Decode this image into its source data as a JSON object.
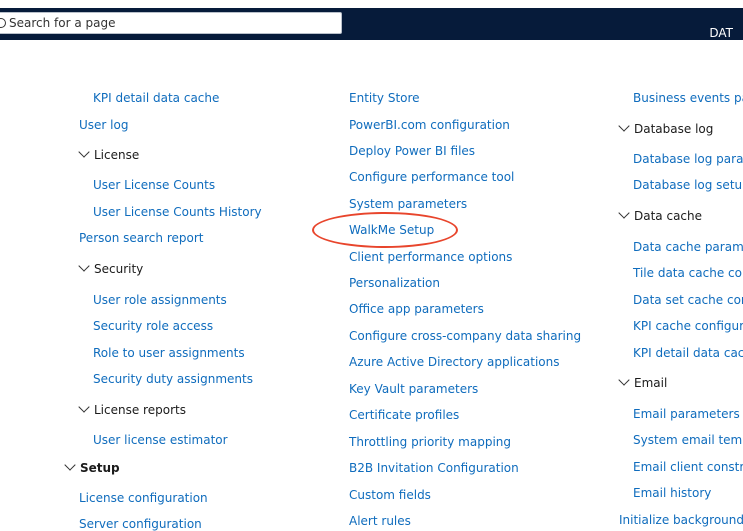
{
  "header": {
    "search_placeholder": "Search for a page",
    "company": "DAT"
  },
  "columns": [
    [
      {
        "label": "KPI detail data cache",
        "type": "link"
      },
      {
        "label": "User log",
        "type": "link"
      },
      {
        "label": "License",
        "type": "group"
      },
      {
        "label": "User License Counts",
        "type": "link"
      },
      {
        "label": "User License Counts History",
        "type": "link"
      },
      {
        "label": "Person search report",
        "type": "link"
      },
      {
        "label": "Security",
        "type": "group"
      },
      {
        "label": "User role assignments",
        "type": "link"
      },
      {
        "label": "Security role access",
        "type": "link"
      },
      {
        "label": "Role to user assignments",
        "type": "link"
      },
      {
        "label": "Security duty assignments",
        "type": "link"
      },
      {
        "label": "License reports",
        "type": "group"
      },
      {
        "label": "User license estimator",
        "type": "link"
      },
      {
        "label": "Setup",
        "type": "group"
      },
      {
        "label": "License configuration",
        "type": "link"
      },
      {
        "label": "Server configuration",
        "type": "link"
      }
    ],
    [
      {
        "label": "Entity Store",
        "type": "link"
      },
      {
        "label": "PowerBI.com configuration",
        "type": "link"
      },
      {
        "label": "Deploy Power BI files",
        "type": "link"
      },
      {
        "label": "Configure performance tool",
        "type": "link"
      },
      {
        "label": "System parameters",
        "type": "link"
      },
      {
        "label": "WalkMe Setup",
        "type": "link"
      },
      {
        "label": "Client performance options",
        "type": "link"
      },
      {
        "label": "Personalization",
        "type": "link"
      },
      {
        "label": "Office app parameters",
        "type": "link"
      },
      {
        "label": "Configure cross-company data sharing",
        "type": "link"
      },
      {
        "label": "Azure Active Directory applications",
        "type": "link"
      },
      {
        "label": "Key Vault parameters",
        "type": "link"
      },
      {
        "label": "Certificate profiles",
        "type": "link"
      },
      {
        "label": "Throttling priority mapping",
        "type": "link"
      },
      {
        "label": "B2B Invitation Configuration",
        "type": "link"
      },
      {
        "label": "Custom fields",
        "type": "link"
      },
      {
        "label": "Alert rules",
        "type": "link"
      }
    ],
    [
      {
        "label": "Business events para",
        "type": "link"
      },
      {
        "label": "Database log",
        "type": "group"
      },
      {
        "label": "Database log parame",
        "type": "link"
      },
      {
        "label": "Database log setup",
        "type": "link"
      },
      {
        "label": "Data cache",
        "type": "group"
      },
      {
        "label": "Data cache paramete",
        "type": "link"
      },
      {
        "label": "Tile data cache confi",
        "type": "link"
      },
      {
        "label": "Data set cache config",
        "type": "link"
      },
      {
        "label": "KPI cache configurati",
        "type": "link"
      },
      {
        "label": "KPI detail data cache",
        "type": "link"
      },
      {
        "label": "Email",
        "type": "group"
      },
      {
        "label": "Email parameters",
        "type": "link"
      },
      {
        "label": "System email templa",
        "type": "link"
      },
      {
        "label": "Email client constrair",
        "type": "link"
      },
      {
        "label": "Email history",
        "type": "link"
      },
      {
        "label": "Initialize background pr",
        "type": "link"
      }
    ]
  ]
}
